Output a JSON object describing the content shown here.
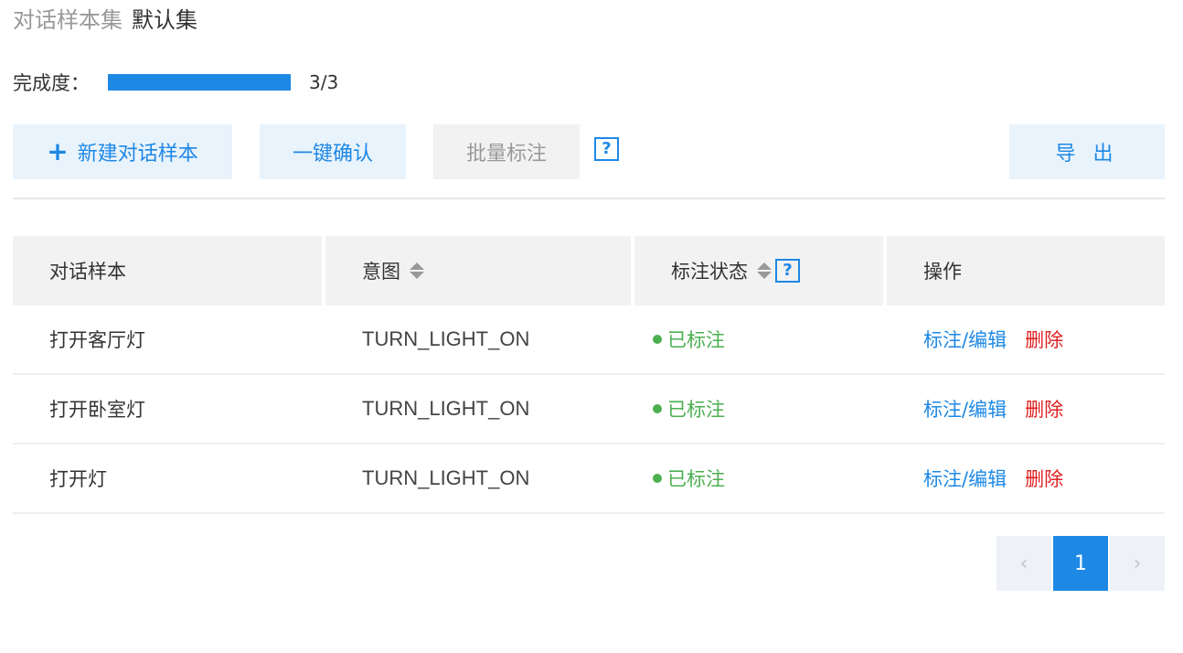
{
  "header": {
    "title_prefix": "对话样本集",
    "set_name": "默认集"
  },
  "progress": {
    "label": "完成度：",
    "fraction": 1.0,
    "count_text": "3/3"
  },
  "toolbar": {
    "new_plus": "+",
    "new_label": "新建对话样本",
    "confirm_label": "一键确认",
    "batch_label": "批量标注",
    "help_glyph": "?",
    "export_label": "导 出"
  },
  "table": {
    "headers": {
      "sample": "对话样本",
      "intent": "意图",
      "status": "标注状态",
      "status_help": "?",
      "actions": "操作"
    },
    "rows": [
      {
        "sample": "打开客厅灯",
        "intent": "TURN_LIGHT_ON",
        "status": "已标注",
        "edit": "标注/编辑",
        "delete": "删除"
      },
      {
        "sample": "打开卧室灯",
        "intent": "TURN_LIGHT_ON",
        "status": "已标注",
        "edit": "标注/编辑",
        "delete": "删除"
      },
      {
        "sample": "打开灯",
        "intent": "TURN_LIGHT_ON",
        "status": "已标注",
        "edit": "标注/编辑",
        "delete": "删除"
      }
    ]
  },
  "pagination": {
    "prev": "‹",
    "current": "1",
    "next": "›"
  },
  "colors": {
    "accent": "#1e88e5",
    "success": "#4caf50",
    "danger": "#e02020"
  }
}
